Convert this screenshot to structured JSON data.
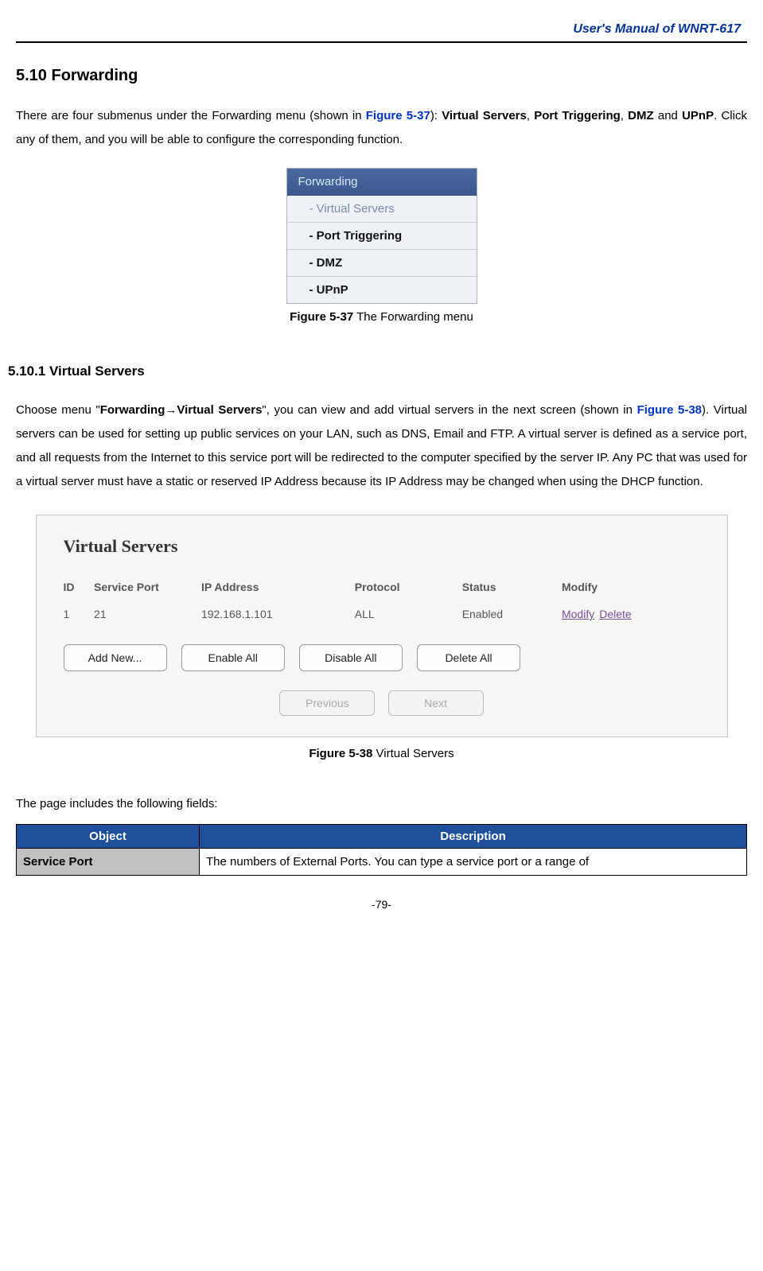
{
  "header": {
    "title": "User's Manual of WNRT-617"
  },
  "section": {
    "heading": "5.10  Forwarding",
    "intro_prefix": "There are four submenus under the Forwarding menu (shown in ",
    "intro_figref": "Figure 5-37",
    "intro_mid": "): ",
    "intro_bold1": "Virtual Servers",
    "intro_sep1": ", ",
    "intro_bold2": "Port Triggering",
    "intro_sep2": ", ",
    "intro_bold3": "DMZ",
    "intro_and": " and ",
    "intro_bold4": "UPnP",
    "intro_tail": ". Click any of them, and you will be able to configure the corresponding function."
  },
  "menu537": {
    "header": "Forwarding",
    "items": [
      {
        "label": "- Virtual Servers",
        "active": false
      },
      {
        "label": "- Port Triggering",
        "active": true
      },
      {
        "label": "- DMZ",
        "active": true
      },
      {
        "label": "- UPnP",
        "active": true
      }
    ],
    "caption_strong": "Figure 5-37",
    "caption_text": "    The Forwarding menu"
  },
  "subsection": {
    "heading": "5.10.1  Virtual Servers",
    "p1_a": "Choose menu \"",
    "p1_bold": "Forwarding→Virtual Servers",
    "p1_b": "\", you can view and add virtual servers in the next screen (shown in ",
    "p1_figref": "Figure 5-38",
    "p1_c": "). Virtual servers can be used for setting up public services on your LAN, such as DNS, Email and FTP. A virtual server is defined as a service port, and all requests from the Internet to this service port will be redirected to the computer specified by the server IP. Any PC that was used for a virtual server must have a static or reserved IP Address because its IP Address may be changed when using the DHCP function."
  },
  "panel538": {
    "title": "Virtual Servers",
    "columns": {
      "id": "ID",
      "service_port": "Service Port",
      "ip": "IP Address",
      "protocol": "Protocol",
      "status": "Status",
      "modify": "Modify"
    },
    "rows": [
      {
        "id": "1",
        "service_port": "21",
        "ip": "192.168.1.101",
        "protocol": "ALL",
        "status": "Enabled",
        "modify_label": "Modify",
        "delete_label": "Delete"
      }
    ],
    "buttons": {
      "add": "Add New...",
      "enable_all": "Enable All",
      "disable_all": "Disable All",
      "delete_all": "Delete All"
    },
    "pager": {
      "prev": "Previous",
      "next": "Next"
    },
    "caption_strong": "Figure 5-38",
    "caption_text": "    Virtual Servers"
  },
  "fields_intro": "The page includes the following fields:",
  "obj_table": {
    "head_obj": "Object",
    "head_desc": "Description",
    "rows": [
      {
        "obj": "Service Port",
        "desc": "The numbers of External Ports. You can type a service port or a range of"
      }
    ]
  },
  "page_number": "-79-"
}
